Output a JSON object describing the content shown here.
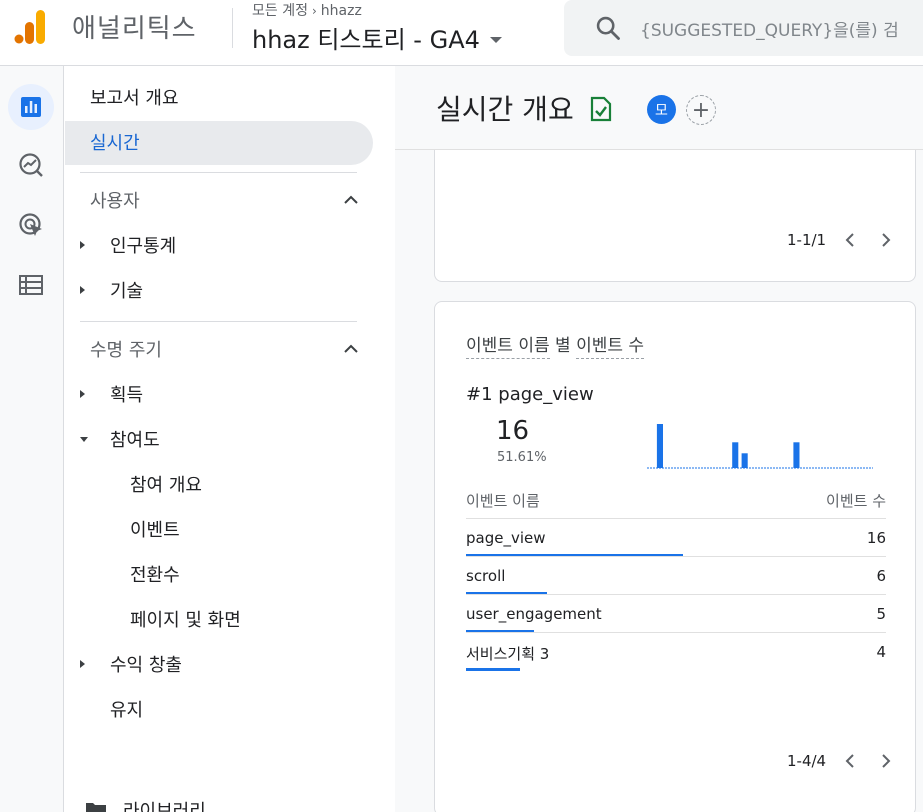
{
  "app": {
    "name": "애널리틱스",
    "breadcrumb_root": "모든 계정",
    "breadcrumb_account": "hhazz",
    "property": "hhaz 티스토리 - GA4",
    "search_placeholder": "{SUGGESTED_QUERY}을(를) 검"
  },
  "rail": {
    "items": [
      {
        "icon": "reports-icon",
        "active": true
      },
      {
        "icon": "explore-icon",
        "active": false
      },
      {
        "icon": "advertising-icon",
        "active": false
      },
      {
        "icon": "configure-icon",
        "active": false
      }
    ]
  },
  "nav": {
    "overview": "보고서 개요",
    "realtime": "실시간",
    "user_section": "사용자",
    "demographics": "인구통계",
    "tech": "기술",
    "lifecycle_section": "수명 주기",
    "acquisition": "획득",
    "engagement": "참여도",
    "engagement_overview": "참여 개요",
    "events": "이벤트",
    "conversions": "전환수",
    "pages_screens": "페이지 및 화면",
    "monetization": "수익 창출",
    "retention": "유지",
    "library": "라이브러리"
  },
  "main": {
    "title": "실시간 개요",
    "avatar_letter": "모",
    "add_label": "+",
    "card1_pager": "1-1/1"
  },
  "events_card": {
    "title_part1": "이벤트 이름",
    "title_mid": " 별 ",
    "title_part2": "이벤트 수",
    "top_rank": "#1",
    "top_name": "page_view",
    "top_value": "16",
    "top_percent": "51.61%",
    "col_name": "이벤트 이름",
    "col_count": "이벤트 수",
    "rows": [
      {
        "name": "page_view",
        "count": "16",
        "share": 1.0
      },
      {
        "name": "scroll",
        "count": "6",
        "share": 0.375
      },
      {
        "name": "user_engagement",
        "count": "5",
        "share": 0.3125
      },
      {
        "name": "서비스기획 3",
        "count": "4",
        "share": 0.25
      }
    ],
    "pager": "1-4/4",
    "spark_values": [
      0,
      0,
      12,
      0,
      0,
      0,
      0,
      0,
      0,
      0,
      0,
      0,
      0,
      0,
      0,
      0,
      0,
      0,
      7,
      0,
      4,
      0,
      0,
      0,
      0,
      0,
      0,
      0,
      0,
      0,
      0,
      7,
      0,
      0,
      0,
      0,
      0,
      0,
      0,
      0,
      0,
      0,
      0,
      0,
      0,
      0,
      0,
      0
    ]
  },
  "colors": {
    "brand_orange": "#f9ab00",
    "brand_orange_dark": "#e37400",
    "accent_blue": "#1a73e8",
    "check_green": "#188038"
  }
}
